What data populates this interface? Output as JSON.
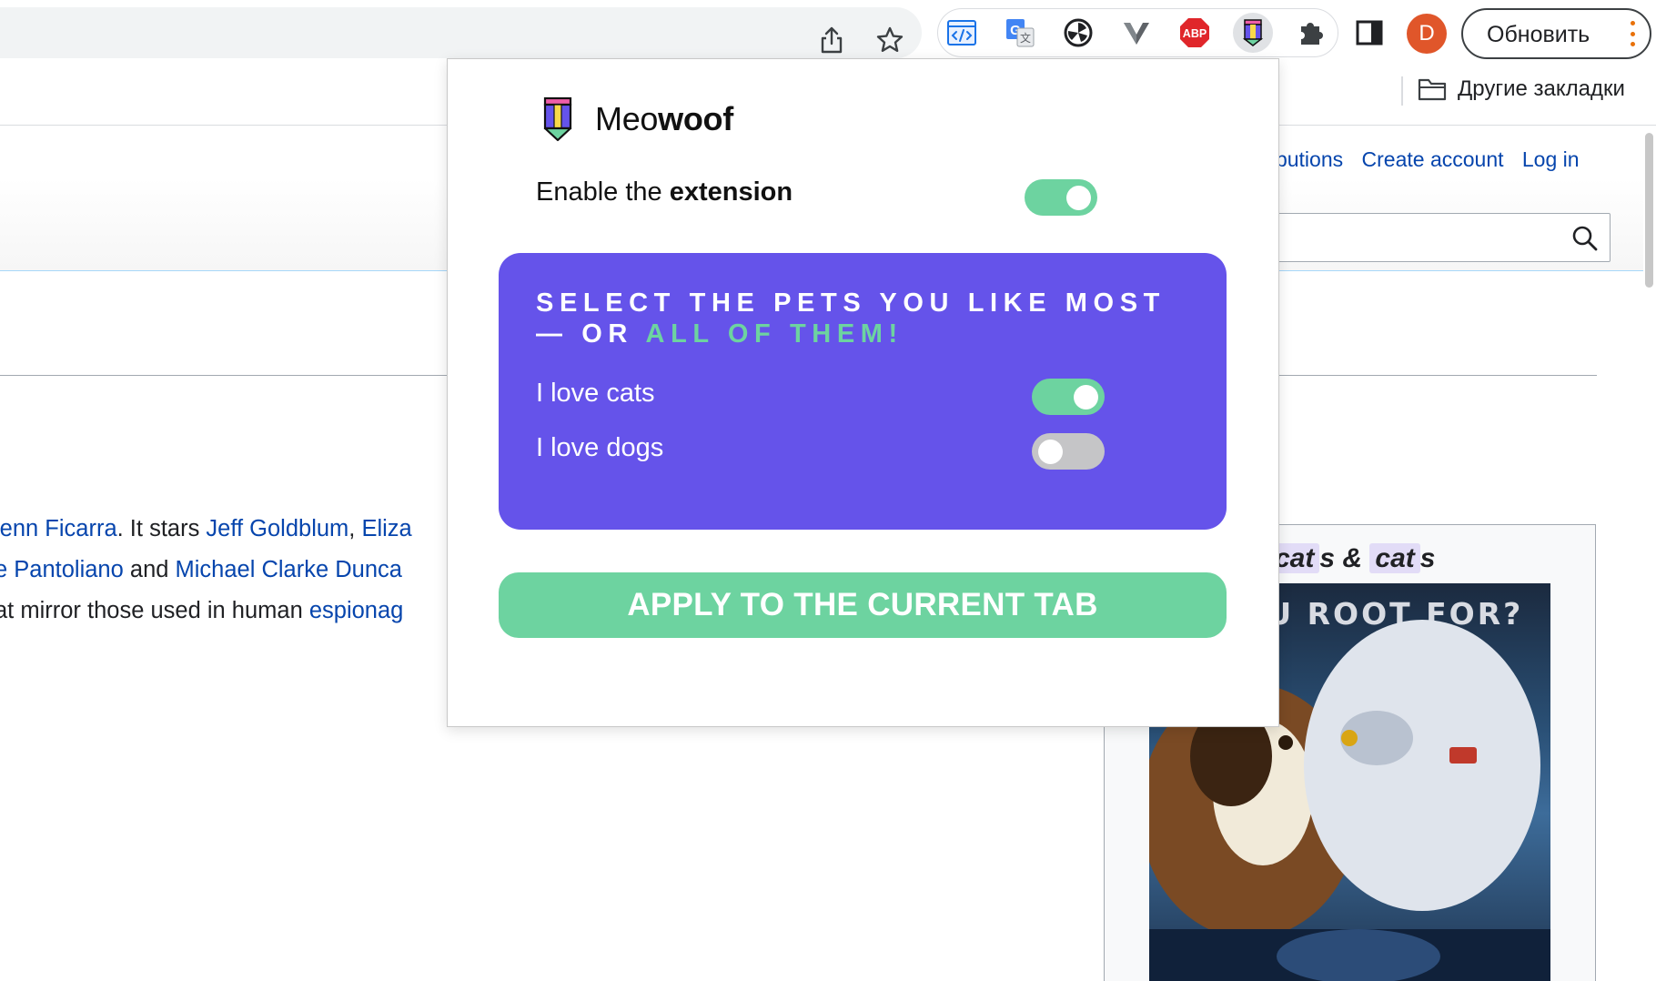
{
  "browser": {
    "update_label": "Обновить",
    "avatar_letter": "D",
    "bookmarks": {
      "other_bookmarks": "Другие закладки"
    },
    "extensions": [
      "code-view-icon",
      "google-translate-icon",
      "pinwheel-icon",
      "v-extension-icon",
      "adblock-plus-icon",
      "meowoof-icon",
      "puzzle-extensions-icon",
      "side-panel-icon"
    ],
    "abp_text": "ABP"
  },
  "page": {
    "user_links": {
      "contributions": "ntributions",
      "create_account": "Create account",
      "log_in": "Log in"
    },
    "article": {
      "line1": [
        {
          "t": "lenn Ficarra",
          "link": true
        },
        {
          "t": ". It stars ",
          "link": false
        },
        {
          "t": "Jeff Goldblum",
          "link": true
        },
        {
          "t": ", ",
          "link": false
        },
        {
          "t": "Eliza",
          "link": true
        }
      ],
      "line2": [
        {
          "t": "e Pantoliano",
          "link": true
        },
        {
          "t": " and ",
          "link": false
        },
        {
          "t": "Michael Clarke Dunca",
          "link": true
        }
      ],
      "line3": [
        {
          "t": "at mirror those used in human ",
          "link": false
        },
        {
          "t": "espionag",
          "link": true
        }
      ]
    },
    "infobox": {
      "title_part1": "cat",
      "title_part2": "s & ",
      "title_part3": "cat",
      "title_part4": "s",
      "poster_text": "LL YOU ROOT FOR?"
    }
  },
  "popup": {
    "brand_light": "Meo",
    "brand_bold": "woof",
    "enable": {
      "label_prefix": "Enable the ",
      "label_bold": "extension",
      "on": true
    },
    "pets": {
      "title_main": "SELECT THE PETS YOU LIKE MOST — OR ",
      "title_accent": "ALL OF THEM!",
      "items": [
        {
          "label": "I love cats",
          "on": true
        },
        {
          "label": "I love dogs",
          "on": false
        }
      ]
    },
    "apply_label": "APPLY TO THE CURRENT TAB"
  },
  "colors": {
    "accent_green": "#6dd3a0",
    "card_purple": "#6553ea",
    "link_blue": "#0645ad",
    "avatar_orange": "#e0562a"
  }
}
